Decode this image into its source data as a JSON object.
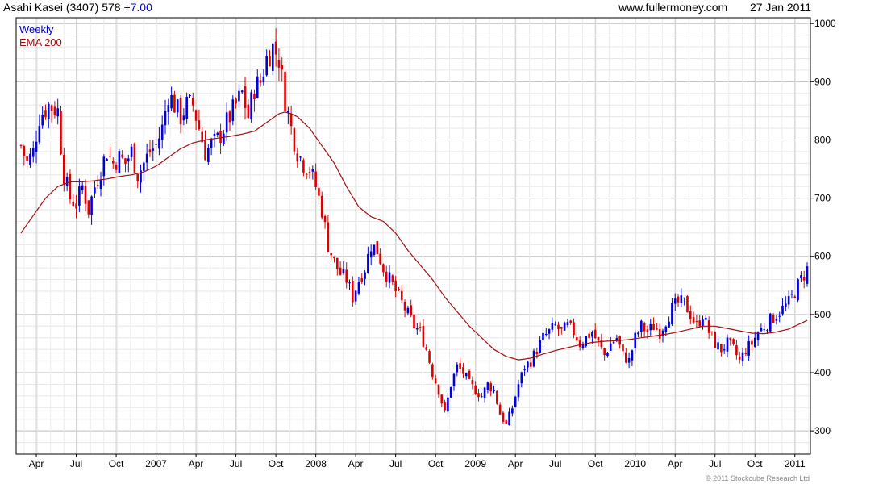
{
  "header": {
    "ticker": "Asahi Kasei (3407)",
    "price": "578",
    "change": "+7.00",
    "website": "www.fullermoney.com",
    "date": "27 Jan 2011"
  },
  "legend": {
    "weekly": "Weekly",
    "ema": "EMA 200"
  },
  "footer": {
    "copyright": "© 2011 Stockcube Research Ltd"
  },
  "colors": {
    "up": "#0000dd",
    "down": "#dd0000",
    "ema": "#a01010",
    "grid": "#d8d8d8"
  },
  "chart_data": {
    "type": "candlestick",
    "ylim": [
      260,
      1010
    ],
    "yticks": [
      300,
      400,
      500,
      600,
      700,
      800,
      900,
      1000
    ],
    "xticks": [
      {
        "label": "Apr",
        "week": 5
      },
      {
        "label": "Jul",
        "week": 18
      },
      {
        "label": "Oct",
        "week": 31
      },
      {
        "label": "2007",
        "week": 44
      },
      {
        "label": "Apr",
        "week": 57
      },
      {
        "label": "Jul",
        "week": 70
      },
      {
        "label": "Oct",
        "week": 83
      },
      {
        "label": "2008",
        "week": 96
      },
      {
        "label": "Apr",
        "week": 109
      },
      {
        "label": "Jul",
        "week": 122
      },
      {
        "label": "Oct",
        "week": 135
      },
      {
        "label": "2009",
        "week": 148
      },
      {
        "label": "Apr",
        "week": 161
      },
      {
        "label": "Jul",
        "week": 174
      },
      {
        "label": "Oct",
        "week": 187
      },
      {
        "label": "2010",
        "week": 200
      },
      {
        "label": "Apr",
        "week": 213
      },
      {
        "label": "Jul",
        "week": 226
      },
      {
        "label": "Oct",
        "week": 239
      },
      {
        "label": "2011",
        "week": 252
      }
    ],
    "close_path": [
      [
        0,
        790
      ],
      [
        2,
        760
      ],
      [
        4,
        780
      ],
      [
        6,
        840
      ],
      [
        9,
        860
      ],
      [
        12,
        850
      ],
      [
        13,
        790
      ],
      [
        14,
        740
      ],
      [
        16,
        700
      ],
      [
        18,
        690
      ],
      [
        20,
        720
      ],
      [
        22,
        680
      ],
      [
        24,
        720
      ],
      [
        26,
        750
      ],
      [
        28,
        780
      ],
      [
        30,
        760
      ],
      [
        32,
        770
      ],
      [
        34,
        760
      ],
      [
        36,
        780
      ],
      [
        38,
        740
      ],
      [
        40,
        760
      ],
      [
        42,
        780
      ],
      [
        44,
        790
      ],
      [
        46,
        820
      ],
      [
        48,
        880
      ],
      [
        50,
        860
      ],
      [
        52,
        840
      ],
      [
        54,
        860
      ],
      [
        56,
        860
      ],
      [
        58,
        820
      ],
      [
        60,
        780
      ],
      [
        62,
        790
      ],
      [
        64,
        800
      ],
      [
        66,
        820
      ],
      [
        68,
        840
      ],
      [
        70,
        860
      ],
      [
        72,
        880
      ],
      [
        74,
        840
      ],
      [
        76,
        890
      ],
      [
        78,
        900
      ],
      [
        80,
        940
      ],
      [
        82,
        960
      ],
      [
        84,
        940
      ],
      [
        86,
        870
      ],
      [
        88,
        820
      ],
      [
        90,
        780
      ],
      [
        92,
        760
      ],
      [
        94,
        750
      ],
      [
        96,
        720
      ],
      [
        98,
        680
      ],
      [
        100,
        620
      ],
      [
        102,
        590
      ],
      [
        104,
        570
      ],
      [
        106,
        560
      ],
      [
        108,
        530
      ],
      [
        110,
        560
      ],
      [
        112,
        580
      ],
      [
        114,
        620
      ],
      [
        116,
        610
      ],
      [
        118,
        580
      ],
      [
        120,
        560
      ],
      [
        122,
        540
      ],
      [
        124,
        520
      ],
      [
        126,
        500
      ],
      [
        128,
        480
      ],
      [
        130,
        470
      ],
      [
        132,
        440
      ],
      [
        134,
        400
      ],
      [
        136,
        370
      ],
      [
        138,
        330
      ],
      [
        140,
        380
      ],
      [
        142,
        410
      ],
      [
        144,
        400
      ],
      [
        146,
        380
      ],
      [
        148,
        370
      ],
      [
        150,
        360
      ],
      [
        152,
        380
      ],
      [
        154,
        370
      ],
      [
        156,
        330
      ],
      [
        158,
        310
      ],
      [
        160,
        340
      ],
      [
        162,
        380
      ],
      [
        164,
        410
      ],
      [
        166,
        420
      ],
      [
        168,
        440
      ],
      [
        170,
        460
      ],
      [
        172,
        470
      ],
      [
        174,
        480
      ],
      [
        176,
        470
      ],
      [
        178,
        480
      ],
      [
        180,
        470
      ],
      [
        182,
        450
      ],
      [
        184,
        460
      ],
      [
        186,
        470
      ],
      [
        188,
        450
      ],
      [
        190,
        430
      ],
      [
        192,
        450
      ],
      [
        194,
        460
      ],
      [
        196,
        430
      ],
      [
        198,
        420
      ],
      [
        200,
        460
      ],
      [
        202,
        480
      ],
      [
        204,
        470
      ],
      [
        206,
        480
      ],
      [
        208,
        470
      ],
      [
        210,
        490
      ],
      [
        212,
        510
      ],
      [
        214,
        520
      ],
      [
        216,
        520
      ],
      [
        218,
        500
      ],
      [
        220,
        480
      ],
      [
        222,
        500
      ],
      [
        224,
        470
      ],
      [
        226,
        450
      ],
      [
        228,
        440
      ],
      [
        230,
        450
      ],
      [
        232,
        440
      ],
      [
        234,
        420
      ],
      [
        236,
        440
      ],
      [
        238,
        450
      ],
      [
        240,
        470
      ],
      [
        242,
        480
      ],
      [
        244,
        490
      ],
      [
        246,
        500
      ],
      [
        248,
        510
      ],
      [
        250,
        520
      ],
      [
        252,
        540
      ],
      [
        254,
        560
      ],
      [
        256,
        578
      ]
    ],
    "ema_path": [
      [
        0,
        640
      ],
      [
        4,
        670
      ],
      [
        8,
        700
      ],
      [
        12,
        720
      ],
      [
        16,
        728
      ],
      [
        20,
        728
      ],
      [
        24,
        730
      ],
      [
        28,
        733
      ],
      [
        32,
        737
      ],
      [
        36,
        740
      ],
      [
        40,
        745
      ],
      [
        44,
        755
      ],
      [
        48,
        770
      ],
      [
        52,
        785
      ],
      [
        56,
        795
      ],
      [
        60,
        800
      ],
      [
        64,
        803
      ],
      [
        68,
        806
      ],
      [
        72,
        810
      ],
      [
        76,
        815
      ],
      [
        80,
        830
      ],
      [
        84,
        845
      ],
      [
        86,
        848
      ],
      [
        88,
        845
      ],
      [
        90,
        840
      ],
      [
        94,
        820
      ],
      [
        98,
        790
      ],
      [
        102,
        760
      ],
      [
        106,
        720
      ],
      [
        110,
        685
      ],
      [
        114,
        668
      ],
      [
        118,
        660
      ],
      [
        122,
        640
      ],
      [
        126,
        610
      ],
      [
        130,
        585
      ],
      [
        134,
        560
      ],
      [
        138,
        530
      ],
      [
        142,
        505
      ],
      [
        146,
        480
      ],
      [
        150,
        460
      ],
      [
        154,
        440
      ],
      [
        158,
        428
      ],
      [
        162,
        422
      ],
      [
        166,
        425
      ],
      [
        170,
        432
      ],
      [
        174,
        438
      ],
      [
        178,
        443
      ],
      [
        182,
        448
      ],
      [
        186,
        452
      ],
      [
        190,
        454
      ],
      [
        194,
        455
      ],
      [
        198,
        457
      ],
      [
        202,
        460
      ],
      [
        206,
        463
      ],
      [
        210,
        466
      ],
      [
        214,
        470
      ],
      [
        218,
        475
      ],
      [
        222,
        480
      ],
      [
        226,
        480
      ],
      [
        230,
        476
      ],
      [
        234,
        472
      ],
      [
        238,
        468
      ],
      [
        242,
        467
      ],
      [
        246,
        470
      ],
      [
        250,
        475
      ],
      [
        254,
        485
      ],
      [
        256,
        490
      ]
    ],
    "axes": {
      "y_position": "right",
      "grid": true,
      "weeks_total": 257
    }
  }
}
